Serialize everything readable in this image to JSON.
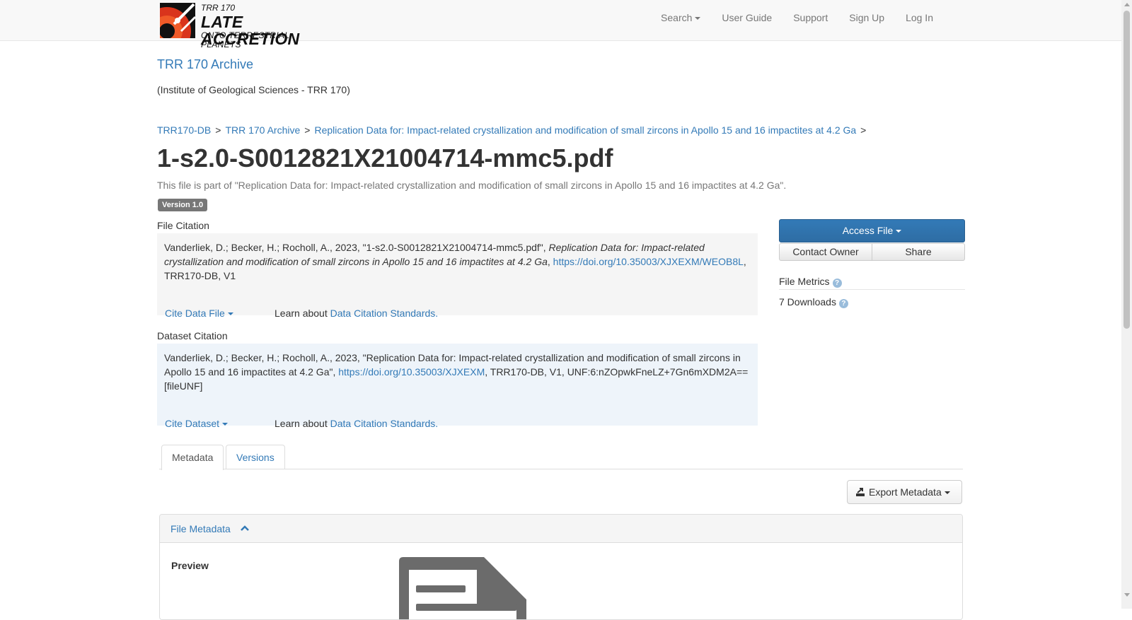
{
  "navbar": {
    "logo": {
      "line1": "TRR 170",
      "line2": "LATE ACCRETION",
      "line3": "ONTO TERRESTRIAL PLANETS"
    },
    "items": [
      {
        "label": "Search",
        "dropdown": true
      },
      {
        "label": "User Guide"
      },
      {
        "label": "Support"
      },
      {
        "label": "Sign Up"
      },
      {
        "label": "Log In"
      }
    ]
  },
  "dataverse": {
    "title": "TRR 170 Archive",
    "affiliation": "(Institute of Geological Sciences - TRR 170)"
  },
  "breadcrumb": [
    "TRR170-DB",
    "TRR 170 Archive",
    "Replication Data for: Impact-related crystallization and modification of small zircons in Apollo 15 and 16 impactites at 4.2 Ga"
  ],
  "breadcrumb_sep": ">",
  "file": {
    "title": "1-s2.0-S0012821X21004714-mmc5.pdf",
    "subtitle": "This file is part of \"Replication Data for: Impact-related crystallization and modification of small zircons in Apollo 15 and 16 impactites at 4.2 Ga\".",
    "version": "Version 1.0"
  },
  "file_citation": {
    "heading": "File Citation",
    "text_start": "Vanderliek, D.; Becker, H.; Rocholl, A., 2023, \"1-s2.0-S0012821X21004714-mmc5.pdf\", ",
    "text_italic": "Replication Data for: Impact-related crystallization and modification of small zircons in Apollo 15 and 16 impactites at 4.2 Ga",
    "text_mid": ", ",
    "doi": "https://doi.org/10.35003/XJXEXM/WEOB8L",
    "text_end": ", TRR170-DB, V1",
    "cite_button": "Cite Data File",
    "learn_prefix": "Learn about ",
    "learn_link": "Data Citation Standards",
    "learn_suffix": "."
  },
  "dataset_citation": {
    "heading": "Dataset Citation",
    "text_start": "Vanderliek, D.; Becker, H.; Rocholl, A., 2023, \"Replication Data for: Impact-related crystallization and modification of small zircons in Apollo 15 and 16 impactites at 4.2 Ga\", ",
    "doi": "https://doi.org/10.35003/XJXEXM",
    "text_end": ", TRR170-DB, V1, UNF:6:nZOpwkFneLZ+7Gn6mXDM2A== [fileUNF]",
    "cite_button": "Cite Dataset",
    "learn_prefix": "Learn about ",
    "learn_link": "Data Citation Standards",
    "learn_suffix": "."
  },
  "actions": {
    "access_file": "Access File",
    "contact_owner": "Contact Owner",
    "share": "Share"
  },
  "metrics": {
    "title": "File Metrics",
    "downloads": "7 Downloads"
  },
  "tabs": [
    {
      "label": "Metadata",
      "active": true
    },
    {
      "label": "Versions",
      "active": false
    }
  ],
  "export_metadata": "Export Metadata",
  "file_metadata": {
    "heading": "File Metadata",
    "preview_label": "Preview"
  },
  "colors": {
    "link": "#337ab7",
    "primary_button": "#337ab7",
    "file_citation_bg": "#f5f5f5",
    "dataset_citation_bg": "#eef4fa",
    "logo_red": "#d9341c"
  }
}
